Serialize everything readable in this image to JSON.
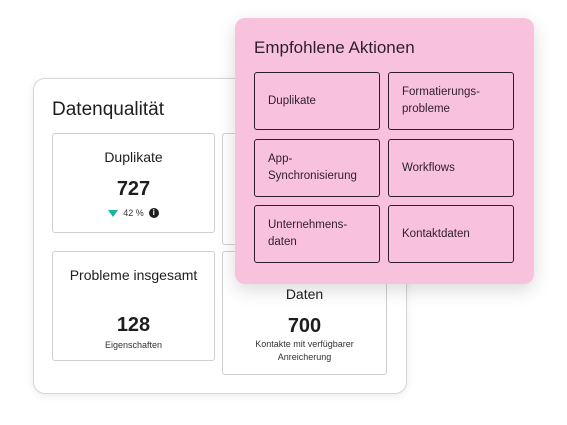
{
  "data_quality": {
    "title": "Datenqualität",
    "duplicates": {
      "title": "Duplikate",
      "value": "727",
      "trend_text": "42 %",
      "trend_direction": "down",
      "trend_color": "#17b5a1",
      "info_icon": "info-icon"
    },
    "problems": {
      "title": "Probleme insgesamt",
      "value": "128",
      "sub": "Eigenschaften"
    },
    "data": {
      "title": "Daten",
      "value": "700",
      "sub": "Kontakte mit verfügbarer Anreicherung"
    }
  },
  "recommended_actions": {
    "title": "Empfohlene Aktionen",
    "background": "#f9c2dc",
    "items": [
      {
        "label": "Duplikate"
      },
      {
        "label": "Formatierungs-\nprobleme"
      },
      {
        "label": "App-\nSynchronisierung"
      },
      {
        "label": "Workflows"
      },
      {
        "label": "Unternehmens-\ndaten"
      },
      {
        "label": "Kontaktdaten"
      }
    ]
  }
}
